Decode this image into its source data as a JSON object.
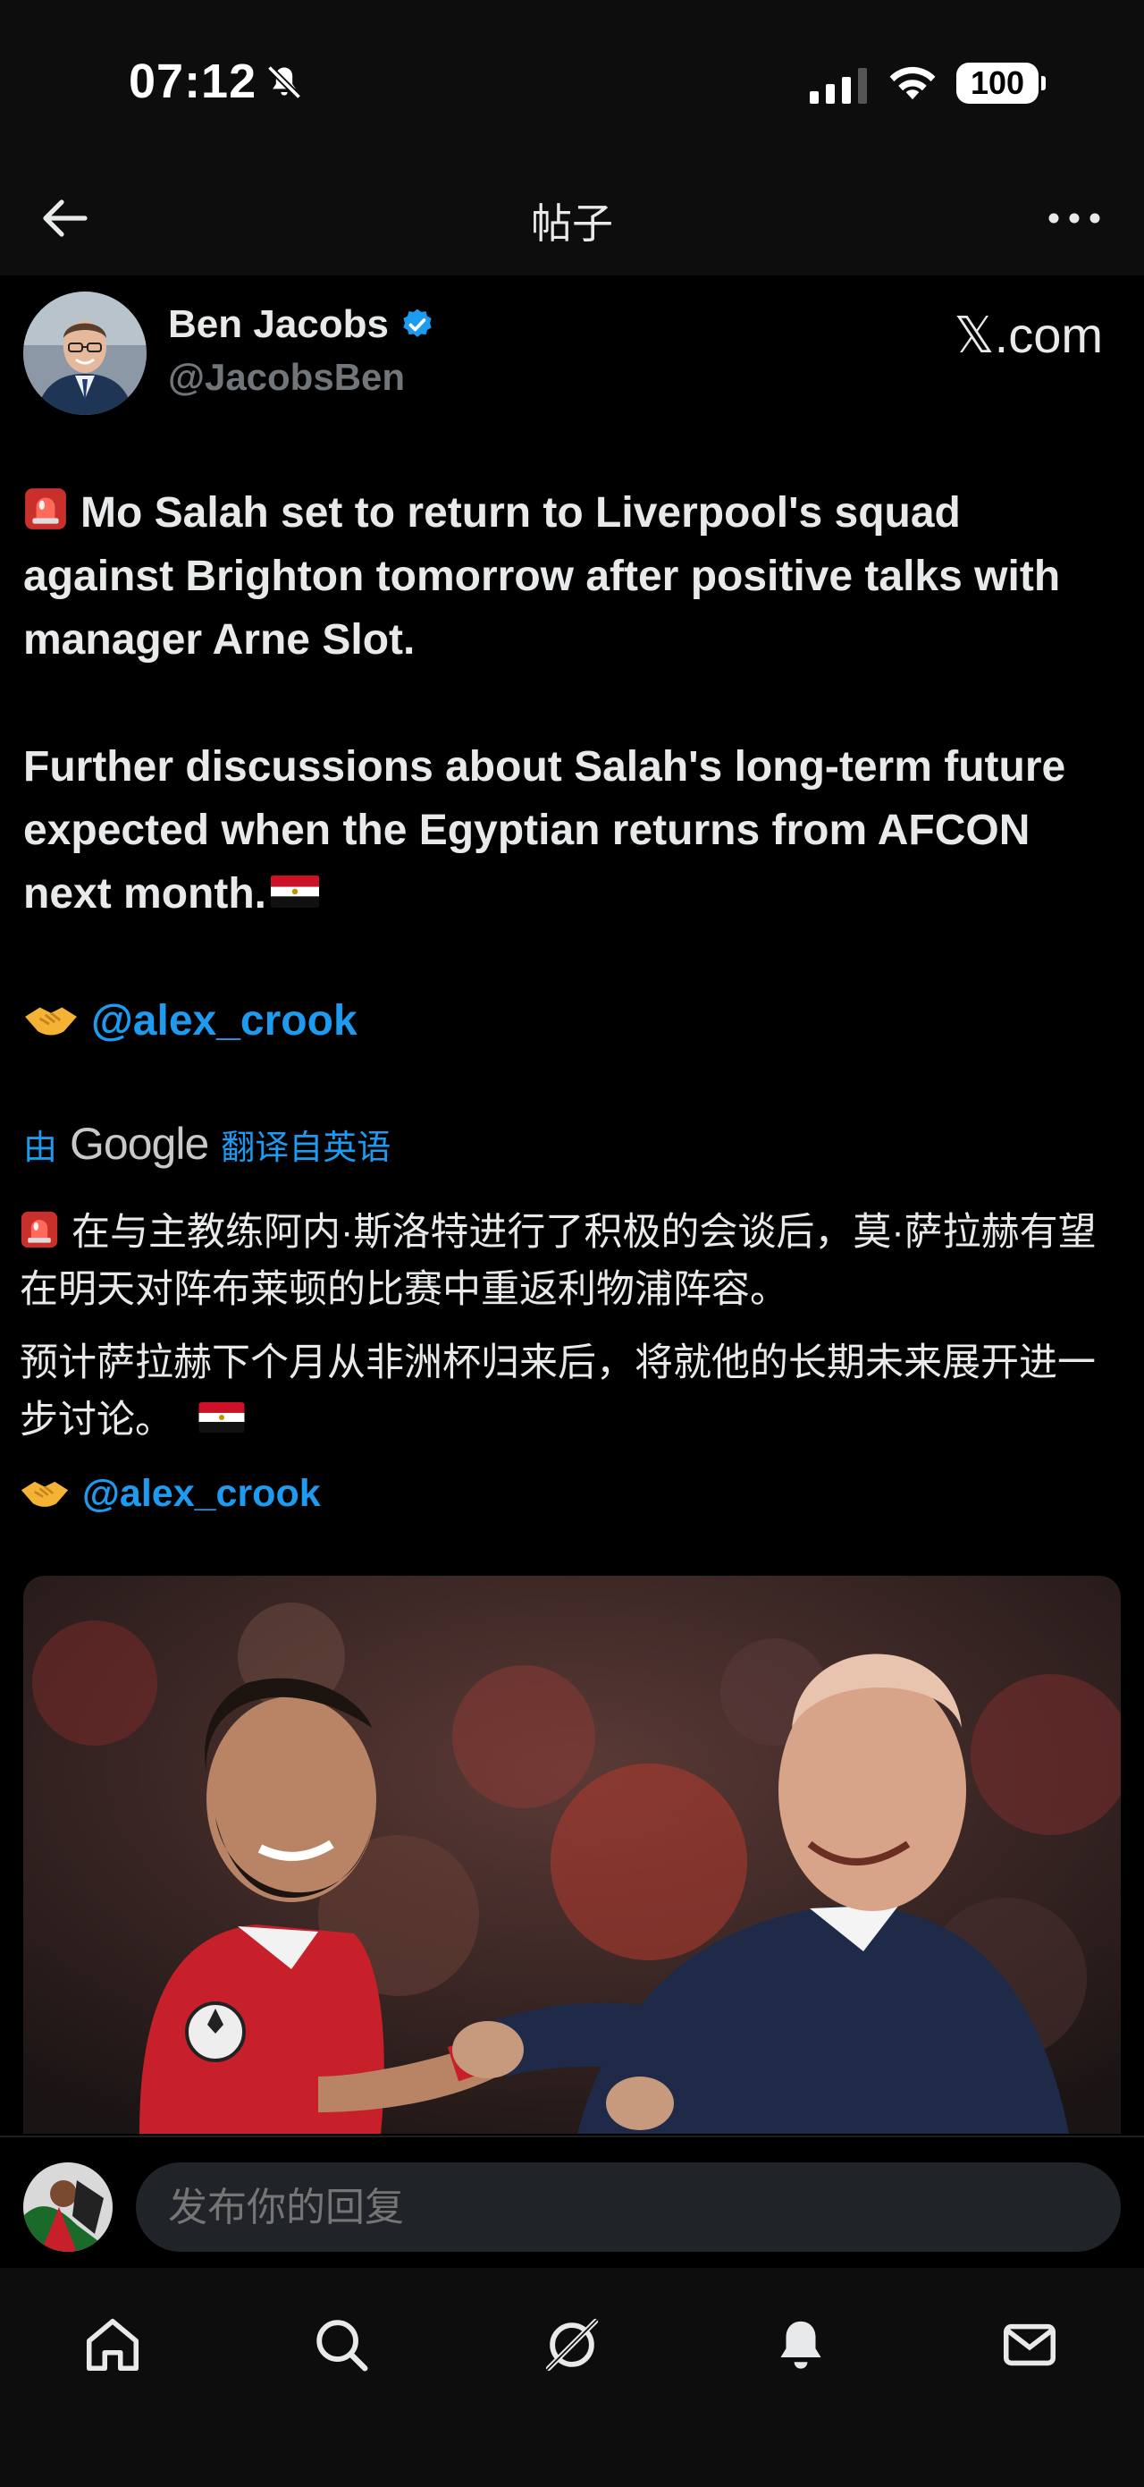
{
  "status_bar": {
    "time": "07:12",
    "battery": "100"
  },
  "header": {
    "title": "帖子"
  },
  "post": {
    "author_name": "Ben Jacobs",
    "author_handle": "@JacobsBen",
    "source": "𝕏.com",
    "text_line1": "Mo Salah set to return to Liverpool's squad against Brighton tomorrow after positive talks with manager Arne Slot.",
    "text_line2": "Further discussions about Salah's long-term future expected when the Egyptian returns from AFCON next month.",
    "mention": "@alex_crook"
  },
  "translation": {
    "by_label": "由",
    "provider": "Google",
    "translated_from": "翻译自英语",
    "text_line1": "在与主教练阿内·斯洛特进行了积极的会谈后，莫·萨拉赫有望在明天对阵布莱顿的比赛中重返利物浦阵容。",
    "text_line2": "预计萨拉赫下个月从非洲杯归来后，将就他的长期未来展开进一步讨论。",
    "mention": "@alex_crook"
  },
  "reply": {
    "placeholder": "发布你的回复"
  },
  "icons": {
    "back": "arrow-left-icon",
    "more": "more-horizontal-icon",
    "verified": "verified-badge-icon",
    "tabs": [
      "home-icon",
      "search-icon",
      "grok-icon",
      "notifications-icon",
      "messages-icon"
    ]
  },
  "colors": {
    "accent": "#1d9bf0",
    "background": "#000000",
    "text": "#e7e9ea",
    "muted": "#71767b"
  }
}
